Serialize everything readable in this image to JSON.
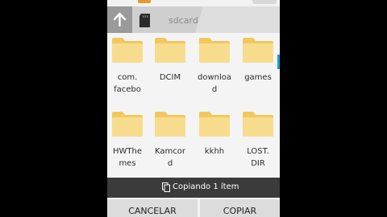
{
  "colors": {
    "path_bar": "#dedede",
    "up_button": "#9a9a9a",
    "folder": "#f5d47a",
    "status_bar": "#3b3b3b",
    "accent_scroll": "#1ba1c6"
  },
  "pathbar": {
    "up_icon": "arrow-up-icon",
    "storage_icon": "sdcard-icon",
    "path": "sdcard"
  },
  "folders": [
    {
      "name": "com.\nfacebo",
      "icon": "folder-icon"
    },
    {
      "name": "DCIM",
      "icon": "folder-icon"
    },
    {
      "name": "downloa\nd",
      "icon": "folder-icon"
    },
    {
      "name": "games",
      "icon": "folder-icon"
    },
    {
      "name": "HWThe\nmes",
      "icon": "folder-icon"
    },
    {
      "name": "Kamcord",
      "icon": "folder-icon"
    },
    {
      "name": "kkhh",
      "icon": "folder-icon"
    },
    {
      "name": "LOST.\nDIR",
      "icon": "folder-icon"
    }
  ],
  "status": {
    "icon": "copy-icon",
    "text": "Copiando 1 ítem"
  },
  "actions": {
    "cancel_label": "CANCELAR",
    "copy_label": "COPIAR"
  }
}
